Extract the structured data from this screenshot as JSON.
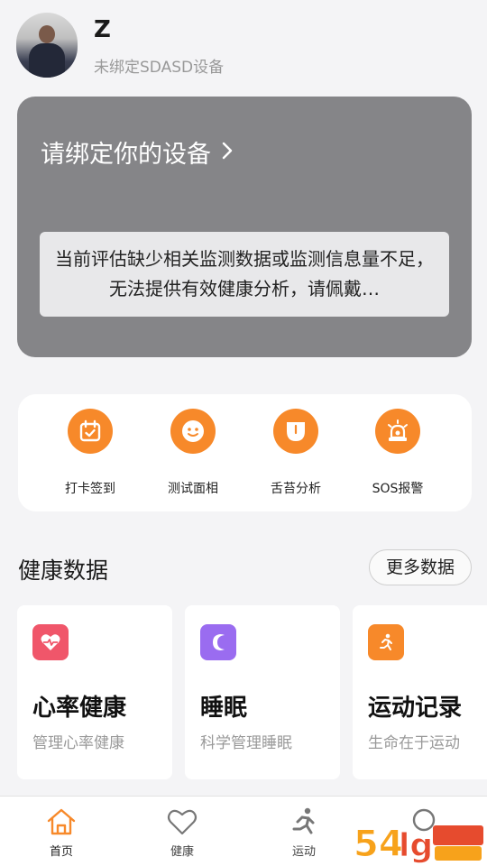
{
  "header": {
    "username": "Z",
    "device_status": "未绑定SDASD设备"
  },
  "bind_card": {
    "title": "请绑定你的设备",
    "notice": "当前评估缺少相关监测数据或监测信息量不足，无法提供有效健康分析，请佩戴…"
  },
  "actions": [
    {
      "label": "打卡签到",
      "icon": "calendar-check-icon"
    },
    {
      "label": "测试面相",
      "icon": "smiley-face-icon"
    },
    {
      "label": "舌苔分析",
      "icon": "tongue-icon"
    },
    {
      "label": "SOS报警",
      "icon": "alarm-light-icon"
    }
  ],
  "health": {
    "section_title": "健康数据",
    "more_label": "更多数据",
    "cards": [
      {
        "title": "心率健康",
        "subtitle": "管理心率健康",
        "icon": "heart-rate-icon",
        "color": "#f0566a"
      },
      {
        "title": "睡眠",
        "subtitle": "科学管理睡眠",
        "icon": "moon-icon",
        "color": "#9a6cf0"
      },
      {
        "title": "运动记录",
        "subtitle": "生命在于运动",
        "icon": "running-icon",
        "color": "#f7892a"
      }
    ]
  },
  "tabbar": {
    "tabs": [
      {
        "label": "首页",
        "icon": "home-icon"
      },
      {
        "label": "健康",
        "icon": "heart-icon"
      },
      {
        "label": "运动",
        "icon": "running-icon"
      },
      {
        "label": "",
        "icon": "search-icon"
      }
    ]
  },
  "colors": {
    "accent": "#f7892a",
    "bind_card_bg": "#858588",
    "heart_tile": "#f0566a",
    "sleep_tile": "#9a6cf0"
  }
}
